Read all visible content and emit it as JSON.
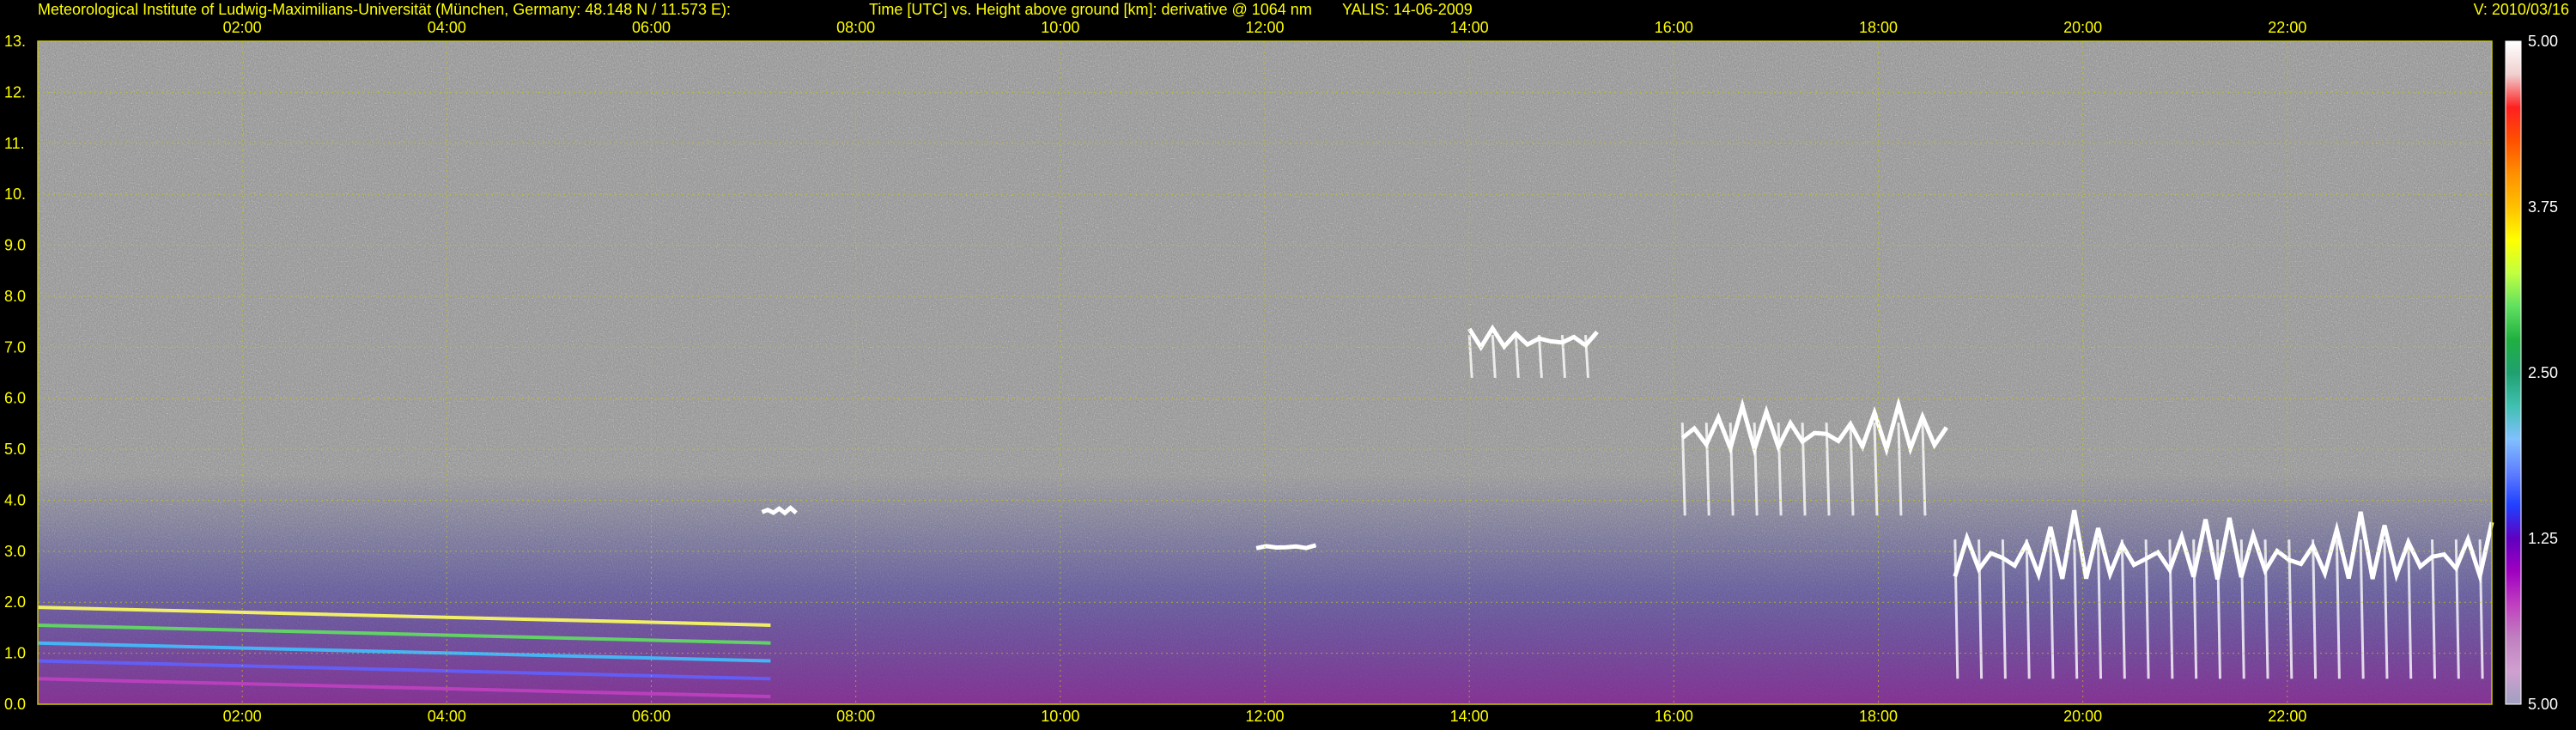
{
  "header": {
    "institute": "Meteorological Institute of Ludwig-Maximilians-Universität (München, Germany: 48.148 N / 11.573 E):",
    "axes_desc": "Time [UTC] vs. Height above ground [km]: derivative @ 1064 nm",
    "instrument": "YALIS: 14-06-2009",
    "version": "V: 2010/03/16"
  },
  "colors": {
    "background": "#000000",
    "axis_text": "#ffff00",
    "grid": "#c8c800",
    "noise": "#8c8c8c",
    "cloud": "#ffffff"
  },
  "chart_data": {
    "type": "heatmap",
    "title": "Time [UTC] vs. Height above ground [km]: derivative @ 1064 nm",
    "xlabel": "Time [UTC]",
    "ylabel": "Height above ground [km]",
    "xlim": [
      "00:00",
      "24:00"
    ],
    "ylim": [
      0.0,
      13.0
    ],
    "grid": true,
    "x_ticks": [
      "02:00",
      "04:00",
      "06:00",
      "08:00",
      "10:00",
      "12:00",
      "14:00",
      "16:00",
      "18:00",
      "20:00",
      "22:00"
    ],
    "y_ticks": [
      "0.0",
      "1.0",
      "2.0",
      "3.0",
      "4.0",
      "5.0",
      "6.0",
      "7.0",
      "8.0",
      "9.0",
      "10.",
      "11.",
      "12.",
      "13."
    ],
    "colorbar": {
      "ticks": [
        "5.00",
        "3.75",
        "2.50",
        "1.25",
        "5.00"
      ],
      "colors": [
        "#ffffff",
        "#f0d0d0",
        "#ff2020",
        "#ff5000",
        "#ff9000",
        "#ffc000",
        "#ffff00",
        "#c0ff40",
        "#60e060",
        "#20b040",
        "#20a070",
        "#40c0b0",
        "#80c0ff",
        "#6080ff",
        "#2040ff",
        "#6000c0",
        "#a000c0",
        "#c040c0",
        "#c080c0",
        "#d0a0d0",
        "#a0a0c0"
      ]
    },
    "features": [
      {
        "name": "aerosol layers",
        "x": [
          "00:00",
          "07:10"
        ],
        "y": [
          0.5,
          1.9
        ]
      },
      {
        "name": "cloud",
        "x": [
          "07:05",
          "07:25"
        ],
        "y": [
          3.6,
          3.9
        ]
      },
      {
        "name": "cloud",
        "x": [
          "11:55",
          "12:30"
        ],
        "y": [
          2.9,
          3.2
        ]
      },
      {
        "name": "cloud",
        "x": [
          "14:00",
          "15:15"
        ],
        "y": [
          6.4,
          7.6
        ]
      },
      {
        "name": "cloud",
        "x": [
          "16:05",
          "18:40"
        ],
        "y": [
          3.7,
          6.3
        ]
      },
      {
        "name": "cloud",
        "x": [
          "18:45",
          "24:00"
        ],
        "y": [
          0.5,
          4.4
        ]
      }
    ]
  }
}
